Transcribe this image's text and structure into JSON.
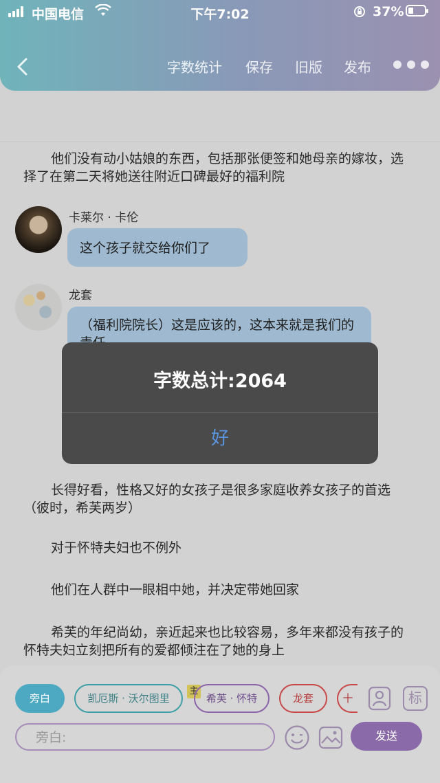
{
  "status_bar": {
    "carrier": "中国电信",
    "time": "下午7:02",
    "battery": "37%",
    "battery_level": 0.37
  },
  "toolbar": {
    "back_icon": "chevron-left-icon",
    "word_count": "字数统计",
    "save": "保存",
    "old_version": "旧版",
    "publish": "发布",
    "more_icon": "more-dots-icon"
  },
  "content": {
    "para_1": "他们没有动小姑娘的东西，包括那张便签和她母亲的嫁妆，选择了在第二天将她送往附近口碑最好的福利院",
    "messages": [
      {
        "speaker": "卡莱尔 · 卡伦",
        "text": "这个孩子就交给你们了"
      },
      {
        "speaker": "龙套",
        "text": "（福利院院长）这是应该的，这本来就是我们的责任"
      }
    ],
    "para_2": "长得好看，性格又好的女孩子是很多家庭收养女孩子的首选（彼时，希芙两岁）",
    "para_3": "对于怀特夫妇也不例外",
    "para_4": "他们在人群中一眼相中她，并决定带她回家",
    "para_5": "希芙的年纪尚幼，亲近起来也比较容易，多年来都没有孩子的怀特夫妇立刻把所有的爱都倾注在了她的身上"
  },
  "dialog": {
    "message": "字数总计:2064",
    "ok": "好"
  },
  "bottom": {
    "roles": [
      "旁白",
      "凯厄斯 · 沃尔图里",
      "希芙 · 怀特",
      "龙套",
      "十"
    ],
    "main_badge": "主",
    "tag_label": "标",
    "input_placeholder": "旁白:",
    "send": "发送"
  },
  "colors": {
    "header_gradient_start": "#1f9ba7",
    "header_gradient_end": "#6e5b95",
    "bubble": "#9fbad0",
    "dialog_bg": "#4a4a4a",
    "dialog_button": "#5a95e0",
    "send_button": "#8b6aa9",
    "narrator_chip": "#4da9c2"
  }
}
